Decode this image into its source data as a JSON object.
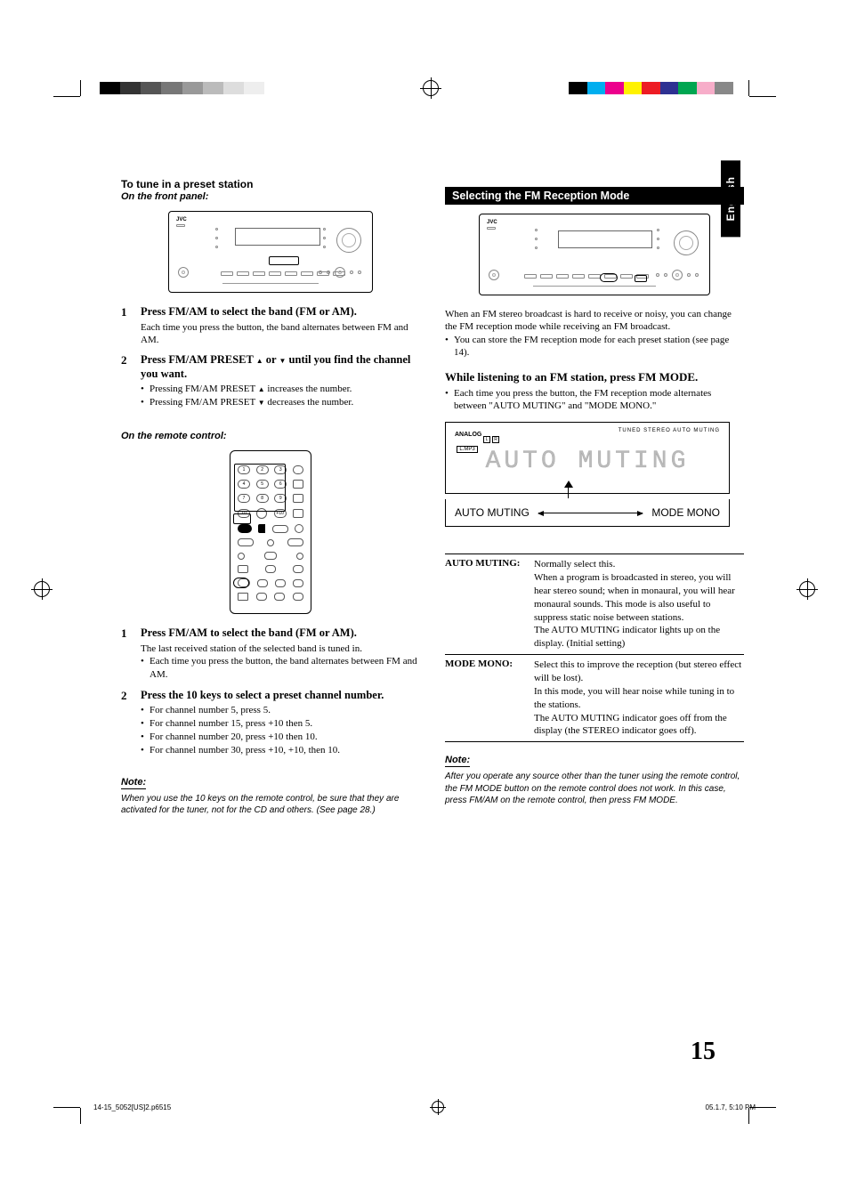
{
  "lang_tab": "English",
  "page_number": "15",
  "left": {
    "heading": "To tune in a preset station",
    "onFront": "On the front panel:",
    "step1": {
      "title": "Press FM/AM to select the band (FM or AM).",
      "text": "Each time you press the button, the band alternates between FM and AM."
    },
    "step2": {
      "title_a": "Press FM/AM PRESET ",
      "title_b": " or ",
      "title_c": " until you find the channel you want.",
      "b1_a": "Pressing FM/AM PRESET ",
      "b1_b": " increases the number.",
      "b2_a": "Pressing FM/AM PRESET ",
      "b2_b": " decreases the number."
    },
    "onRemote": "On the remote control:",
    "r_step1": {
      "title": "Press FM/AM to select the band (FM or AM).",
      "text": "The last received station of the selected band is tuned in.",
      "b1": "Each time you press the button, the band alternates between FM and AM."
    },
    "r_step2": {
      "title": "Press the 10 keys to select a preset channel number.",
      "b1": "For channel number 5, press 5.",
      "b2": "For channel number 15, press +10 then 5.",
      "b3": "For channel number 20, press +10 then 10.",
      "b4": "For channel number 30, press +10, +10, then 10."
    },
    "note_label": "Note:",
    "note_text": "When you use the 10 keys on the remote control, be sure that they are activated for the tuner, not for the CD and others. (See page 28.)"
  },
  "right": {
    "bar": "Selecting the FM Reception Mode",
    "intro": "When an FM stereo broadcast is hard to receive or noisy, you can change the FM reception mode while receiving an FM broadcast.",
    "intro_b": "You can store the FM reception mode for each preset station (see page 14).",
    "listen_title": "While listening to an FM station, press FM MODE.",
    "listen_b": "Each time you press the button, the FM reception mode alternates between \"AUTO MUTING\" and \"MODE MONO.\"",
    "lcd": {
      "tag": "ANALOG",
      "l": "L",
      "r": "R",
      "lmp3": "L.MP3",
      "ind": "TUNED   STEREO   AUTO MUTING",
      "main": "AUTO MUTING"
    },
    "mode_left": "AUTO MUTING",
    "mode_right": "MODE MONO",
    "table": {
      "r1_label": "AUTO MUTING:",
      "r1_a": "Normally select this.",
      "r1_b": "When a program is broadcasted in stereo, you will hear stereo sound; when in monaural, you will hear monaural sounds. This mode is also useful to suppress static noise between stations.",
      "r1_c": "The AUTO MUTING indicator lights up on the display. (Initial setting)",
      "r2_label": "MODE MONO:",
      "r2_a": "Select this to improve the reception (but stereo effect will be lost).",
      "r2_b": "In this mode, you will hear noise while tuning in to the stations.",
      "r2_c": "The AUTO MUTING indicator goes off from the display (the STEREO indicator goes off)."
    },
    "note_label": "Note:",
    "note_text": "After you operate any source other than the tuner using the remote control, the FM MODE button on the remote control does not work. In this case, press FM/AM on the remote control, then press FM MODE."
  },
  "footer": {
    "file": "14-15_5052[US]2.p65",
    "pg": "15",
    "ts": "05.1.7, 5:10 PM"
  },
  "colors": {
    "cyan": "#00aeef",
    "magenta": "#ec008c",
    "yellow": "#fff200",
    "green": "#00a651",
    "blue": "#2e3192",
    "red": "#ed1c24",
    "pink": "#f7adc9"
  }
}
